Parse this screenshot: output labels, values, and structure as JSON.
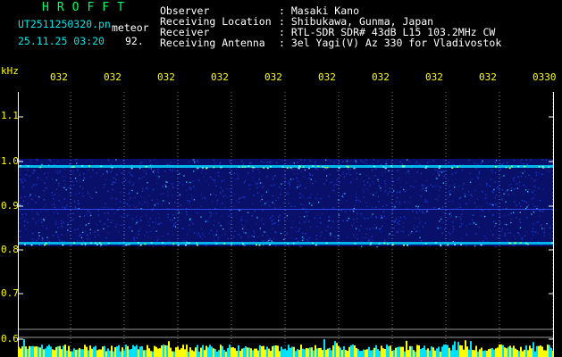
{
  "header": {
    "brand": "HROFFT",
    "filename": "UT2511250320.pn",
    "tag": "meteor",
    "datetime": "25.11.25 03:20",
    "count": "92.",
    "fields": [
      {
        "label": "Observer",
        "value": ": Masaki Kano"
      },
      {
        "label": "Receiving Location",
        "value": ": Shibukawa, Gunma, Japan"
      },
      {
        "label": "Receiver",
        "value": ": RTL-SDR SDR# 43dB L15 103.2MHz CW"
      },
      {
        "label": "Receiving Antenna",
        "value": ": 3el Yagi(V) Az 330 for Vladivostok"
      }
    ]
  },
  "axis": {
    "unit": "kHz",
    "y_ticks": [
      "1.1",
      "1.0",
      "0.9",
      "0.8",
      "0.7",
      "0.6"
    ],
    "time_ticks": [
      "032",
      "032",
      "032",
      "032",
      "032",
      "032",
      "032",
      "032",
      "032",
      "0330"
    ]
  },
  "colors": {
    "background": "#000000",
    "grid": "#ffffff",
    "signal_strong": "#00ffff",
    "signal_weak": "#0000aa",
    "level": "#ffff00"
  }
}
